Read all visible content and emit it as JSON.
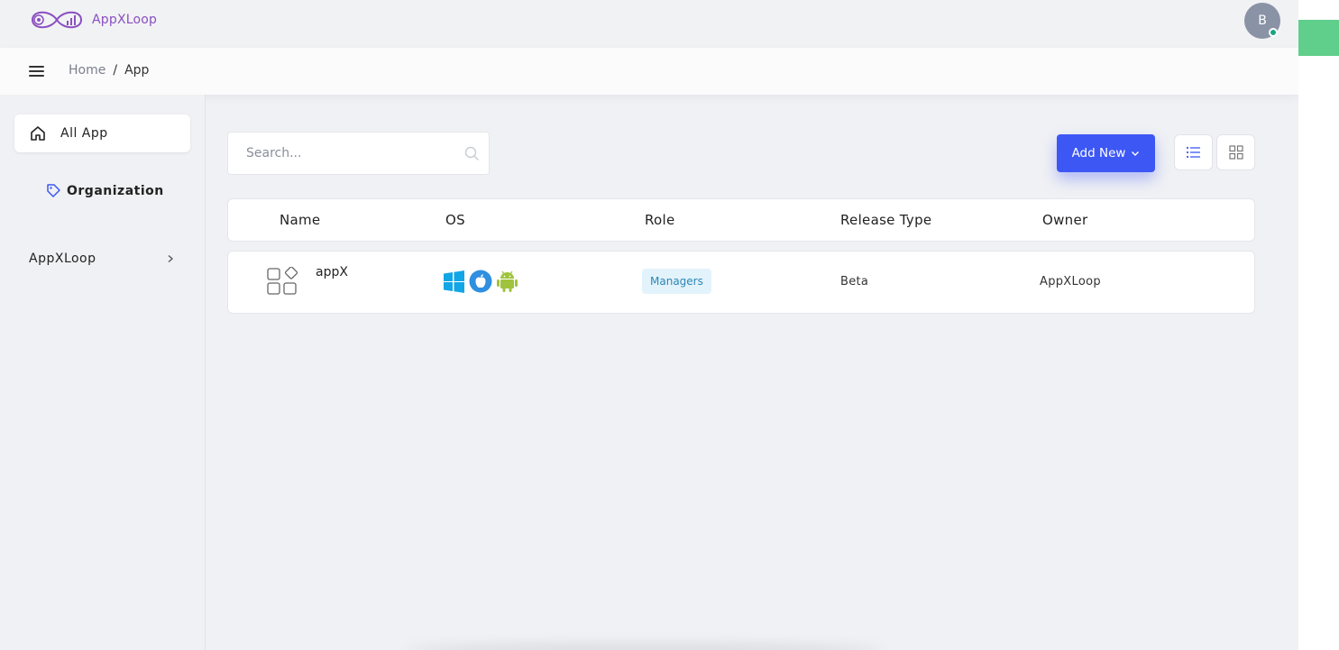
{
  "app": {
    "brand": "AppXLoop",
    "accent_color": "#3d57f5",
    "brand_color": "#8a4fc0"
  },
  "user": {
    "avatar_initial": "B",
    "status": "online"
  },
  "breadcrumb": {
    "home": "Home",
    "separator": "/",
    "current": "App"
  },
  "sidebar": {
    "items": [
      {
        "label": "All App",
        "icon": "home-icon",
        "active": true
      },
      {
        "label": "Organization",
        "icon": "tag-icon"
      },
      {
        "label": "AppXLoop",
        "icon": "chevron-right-icon"
      }
    ]
  },
  "toolbar": {
    "search_placeholder": "Search...",
    "add_new_label": "Add New",
    "views": [
      "list-view-icon",
      "grid-view-icon"
    ]
  },
  "table": {
    "columns": [
      "Name",
      "OS",
      "Role",
      "Release Type",
      "Owner"
    ],
    "rows": [
      {
        "name": "appX",
        "os": [
          "windows-icon",
          "apple-icon",
          "android-icon"
        ],
        "role": "Managers",
        "release_type": "Beta",
        "owner": "AppXLoop"
      }
    ]
  }
}
